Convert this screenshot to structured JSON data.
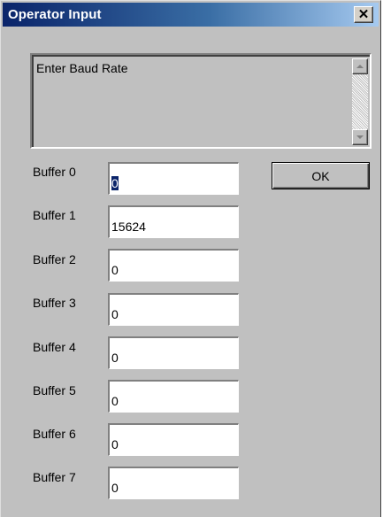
{
  "window": {
    "title": "Operator Input",
    "close_glyph": "✕"
  },
  "message": {
    "text": "Enter Baud Rate"
  },
  "ok_button": {
    "label": "OK"
  },
  "buffers": [
    {
      "label": "Buffer 0",
      "value": "0",
      "selected": true
    },
    {
      "label": "Buffer 1",
      "value": "15624"
    },
    {
      "label": "Buffer 2",
      "value": "0"
    },
    {
      "label": "Buffer 3",
      "value": "0"
    },
    {
      "label": "Buffer 4",
      "value": "0"
    },
    {
      "label": "Buffer 5",
      "value": "0"
    },
    {
      "label": "Buffer 6",
      "value": "0"
    },
    {
      "label": "Buffer 7",
      "value": "0"
    }
  ],
  "colors": {
    "titlebar_start": "#0a246a",
    "titlebar_end": "#a6caf0",
    "face": "#c0c0c0",
    "selection": "#0a246a"
  },
  "icons": {
    "close": "close-icon",
    "scroll_up": "scroll-up-arrow-icon",
    "scroll_down": "scroll-down-arrow-icon"
  }
}
